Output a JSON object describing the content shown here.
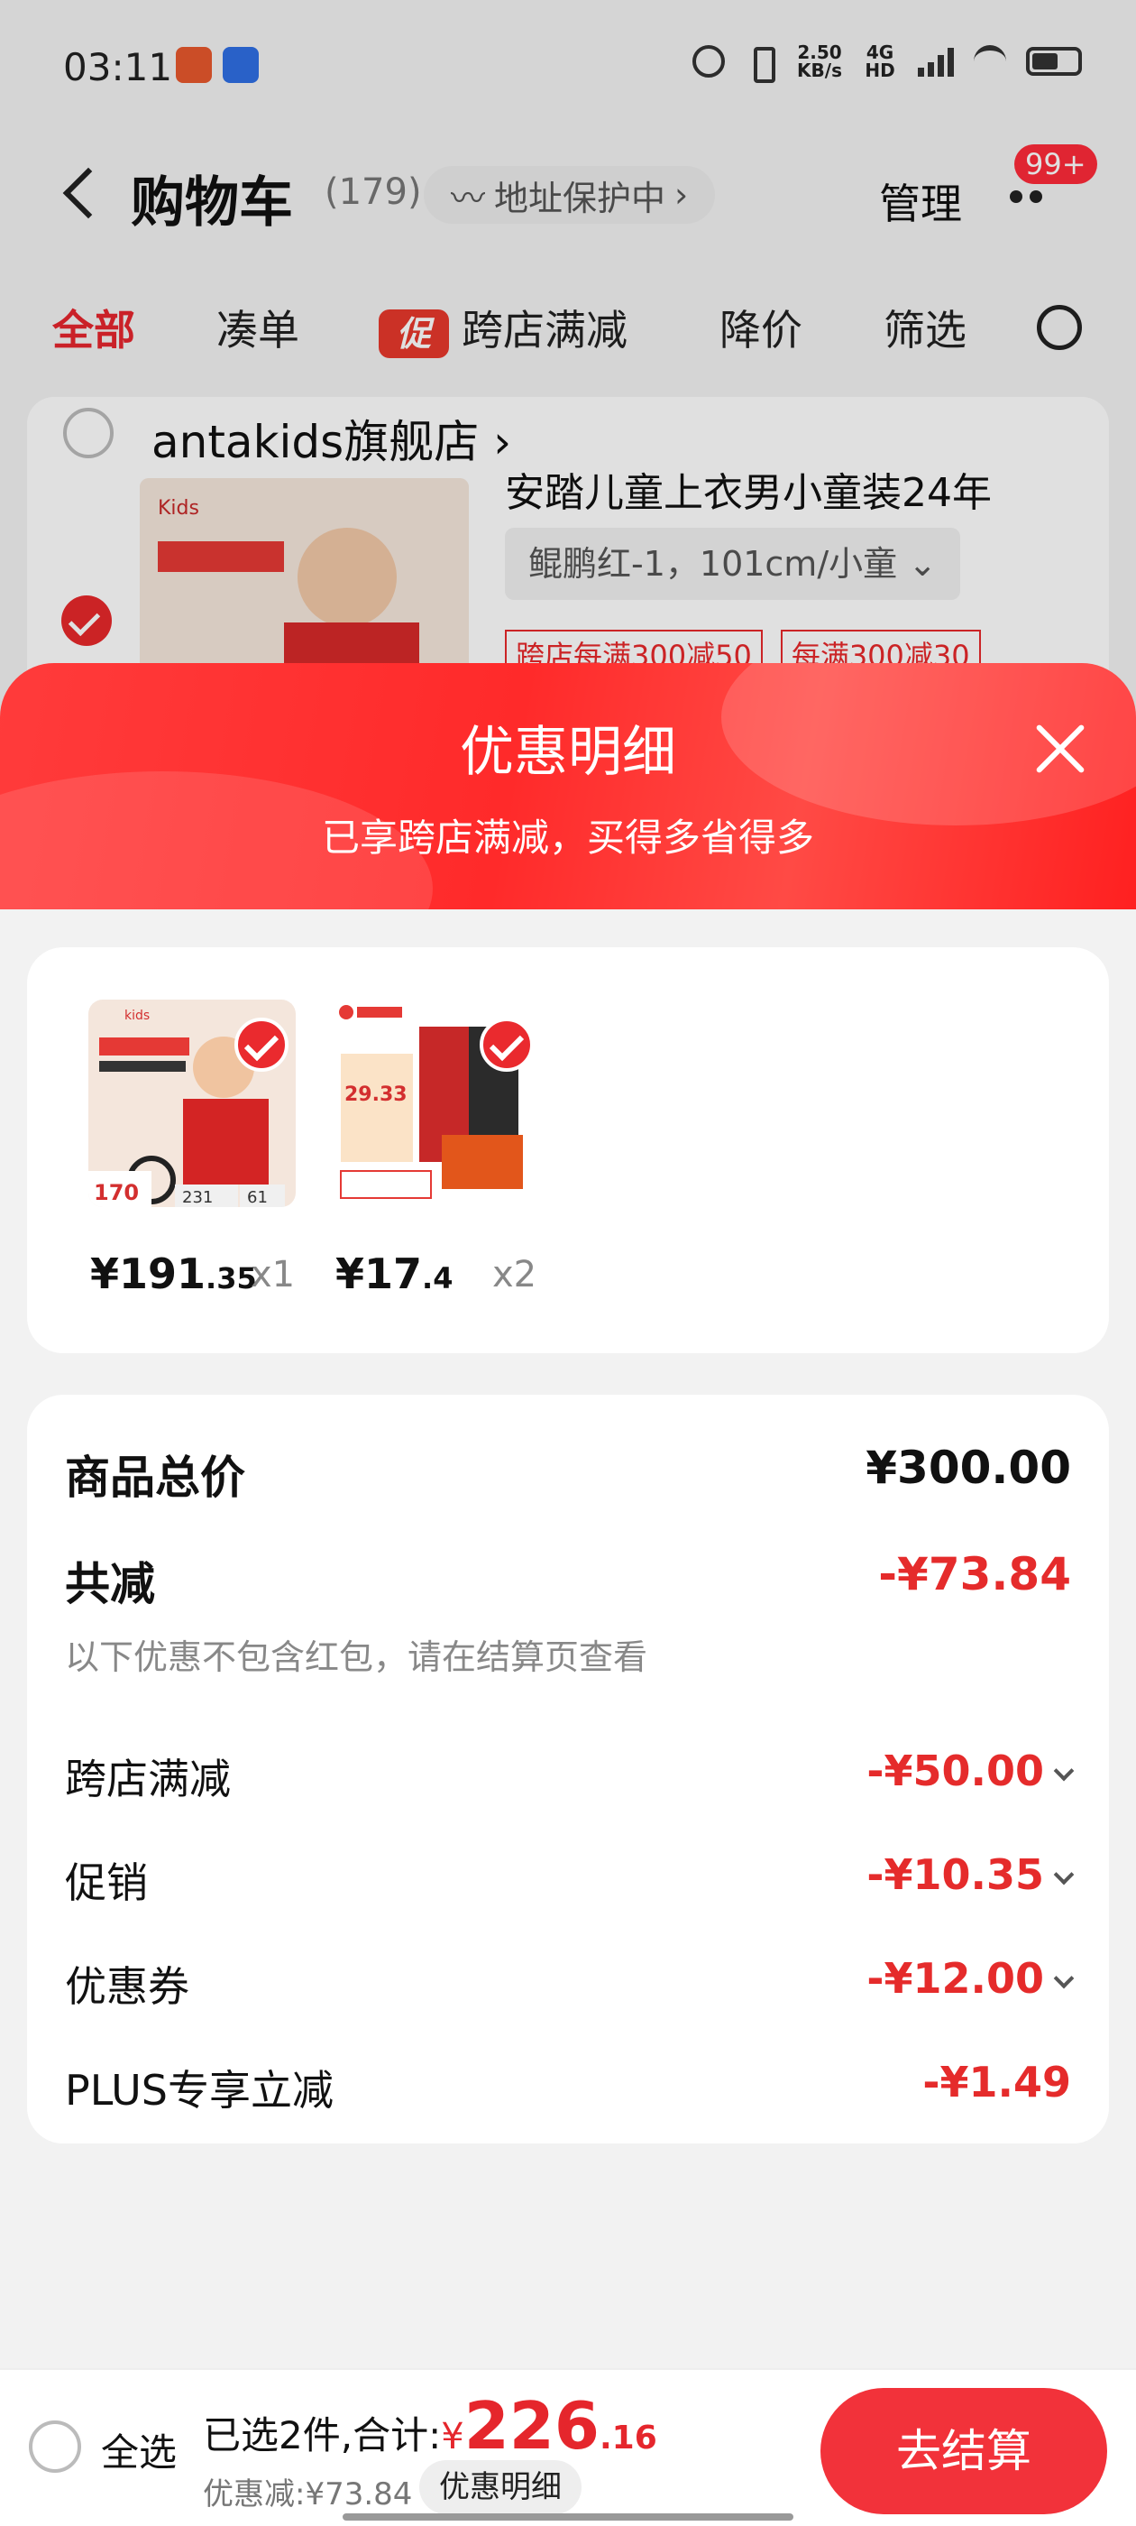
{
  "status_bar": {
    "time": "03:11",
    "net_speed": "2.50",
    "net_unit": "KB/s",
    "network": "4G HD"
  },
  "cart_header": {
    "title": "购物车",
    "count": "(179)",
    "address_pill": "地址保护中",
    "manage": "管理",
    "badge": "99+"
  },
  "tabs": [
    {
      "label": "全部"
    },
    {
      "label": "凑单"
    },
    {
      "label": "跨店满减",
      "chip": "促"
    },
    {
      "label": "降价"
    },
    {
      "label": "筛选"
    }
  ],
  "store": {
    "name": "antakids旗舰店",
    "item_title": "安踏儿童上衣男小童装24年",
    "sku": "鲲鹏红-1，101cm/小童",
    "tags": [
      "跨店每满300减50",
      "每满300减30"
    ]
  },
  "sheet": {
    "title": "优惠明细",
    "subtitle": "已享跨店满减，买得多省得多"
  },
  "products": [
    {
      "price_int": "¥191",
      "price_dec": ".35",
      "qty": "x1",
      "image": "anta-kids-jacket"
    },
    {
      "price_int": "¥17",
      "price_dec": ".4",
      "qty": "x2",
      "image": "haidilao-seasoning"
    }
  ],
  "summary": {
    "total_label": "商品总价",
    "total_value": "¥300.00",
    "discount_label": "共减",
    "discount_value": "-¥73.84",
    "note": "以下优惠不包含红包，请在结算页查看",
    "rows": [
      {
        "label": "跨店满减",
        "value": "-¥50.00",
        "expandable": true
      },
      {
        "label": "促销",
        "value": "-¥10.35",
        "expandable": true
      },
      {
        "label": "优惠券",
        "value": "-¥12.00",
        "expandable": true
      },
      {
        "label": "PLUS专享立减",
        "value": "-¥1.49",
        "expandable": false
      }
    ]
  },
  "bottom_bar": {
    "select_all": "全选",
    "selected_prefix": "已选2件,合计:",
    "currency": "¥",
    "total_int": "226",
    "total_dec": ".16",
    "saving": "优惠减:¥73.84",
    "detail": "优惠明细",
    "checkout": "去结算"
  },
  "colors": {
    "accent": "#e5262c",
    "checkout": "#f2323a"
  }
}
